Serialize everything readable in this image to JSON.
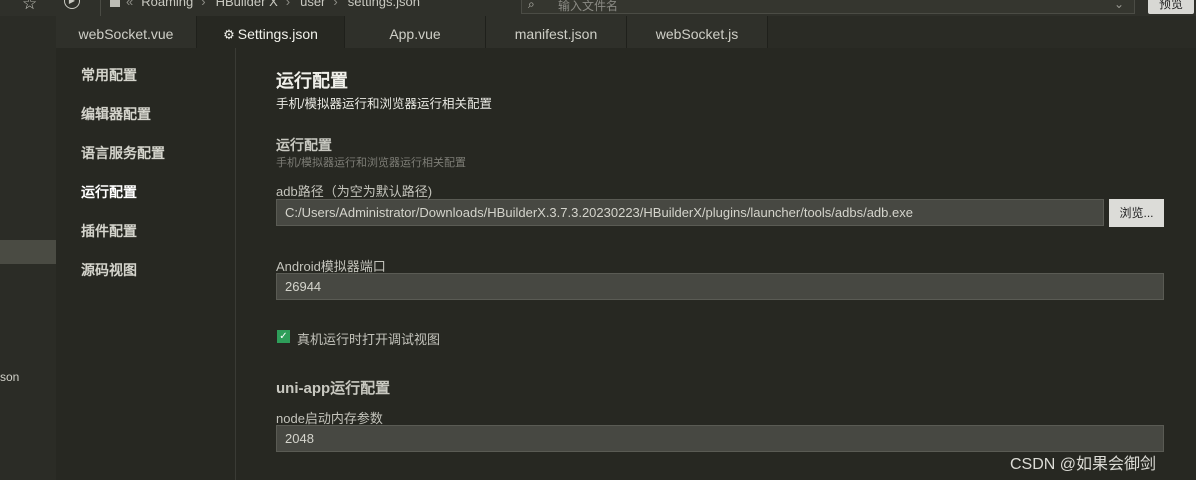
{
  "topbar": {
    "star_icon": "star-icon",
    "play_icon": "play-circle-icon",
    "breadcrumbs": [
      "Roaming",
      "HBuilder X",
      "user",
      "settings.json"
    ],
    "search_placeholder": "输入文件名",
    "preview_label": "预览"
  },
  "left_panel": {
    "visible_item": "son"
  },
  "tabs": [
    {
      "label": "webSocket.vue"
    },
    {
      "label": "Settings.json",
      "active": true
    },
    {
      "label": "App.vue"
    },
    {
      "label": "manifest.json"
    },
    {
      "label": "webSocket.js"
    }
  ],
  "nav": {
    "items": [
      "常用配置",
      "编辑器配置",
      "语言服务配置",
      "运行配置",
      "插件配置",
      "源码视图"
    ]
  },
  "content": {
    "title": "运行配置",
    "subtitle": "手机/模拟器运行和浏览器运行相关配置",
    "section_title": "运行配置",
    "section_subtitle": "手机/模拟器运行和浏览器运行相关配置",
    "adb_label": "adb路径（为空为默认路径)",
    "adb_value": "C:/Users/Administrator/Downloads/HBuilderX.3.7.3.20230223/HBuilderX/plugins/launcher/tools/adbs/adb.exe",
    "browse_label": "浏览...",
    "emulator_label": "Android模拟器端口",
    "emulator_value": "26944",
    "debug_checkbox_label": "真机运行时打开调试视图",
    "debug_checked": true,
    "uniapp_title": "uni-app运行配置",
    "node_label": "node启动内存参数",
    "node_value": "2048"
  },
  "watermark": "CSDN @如果会御剑",
  "colors": {
    "background": "#272822",
    "input_bg": "#474842",
    "checkbox": "#2e9e5a"
  }
}
